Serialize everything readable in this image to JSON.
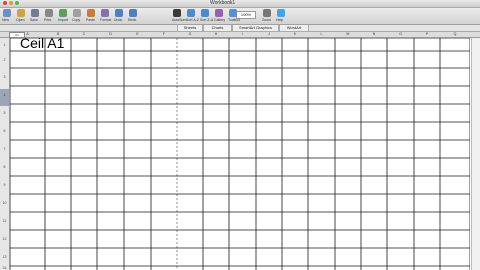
{
  "window": {
    "title": "Workbook1"
  },
  "toolbar": {
    "labels": [
      "New",
      "Open",
      "Save",
      "Print",
      "Import",
      "Copy",
      "Paste",
      "Format",
      "Undo",
      "Redo",
      "AutoSum",
      "Sort A-Z",
      "Sort Z-A",
      "Gallery",
      "Toolbox",
      "Zoom",
      "Help"
    ],
    "zoom": "100%"
  },
  "tabs": [
    "Sheets",
    "Charts",
    "SmartArt Graphics",
    "WordArt"
  ],
  "column_headers": [
    "A",
    "B",
    "C",
    "D",
    "E",
    "F",
    "G",
    "H",
    "I",
    "J",
    "K",
    "L",
    "M",
    "N",
    "O",
    "P",
    "Q"
  ],
  "row_numbers": [
    "1",
    "2",
    "3",
    "4",
    "5",
    "6",
    "7",
    "8",
    "9",
    "10",
    "11",
    "12",
    "13",
    "14"
  ],
  "name_box": "A1",
  "cell_A1": "Ceil A1",
  "colors": {
    "selection": "#9aa6b8",
    "grid": "#1a1a1a",
    "toolbar": "#d8d8d8"
  }
}
